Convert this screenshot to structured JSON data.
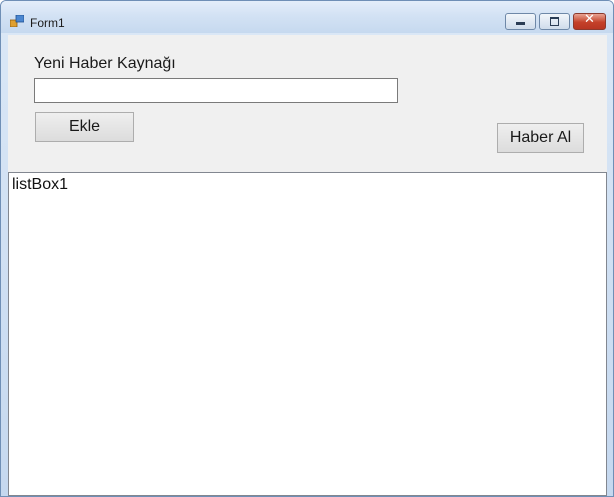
{
  "window": {
    "title": "Form1",
    "controls": {
      "minimize_icon": "minimize-icon",
      "maximize_icon": "maximize-icon",
      "close_icon": "close-icon",
      "close_glyph": "✕"
    }
  },
  "form": {
    "source_label": "Yeni Haber Kaynağı",
    "source_input_value": "",
    "add_button_label": "Ekle",
    "fetch_button_label": "Haber Al",
    "listbox_text": "listBox1"
  },
  "colors": {
    "title_gradient_top": "#e4eefa",
    "client_background": "#f0f0f0",
    "close_button": "#c4412a"
  }
}
